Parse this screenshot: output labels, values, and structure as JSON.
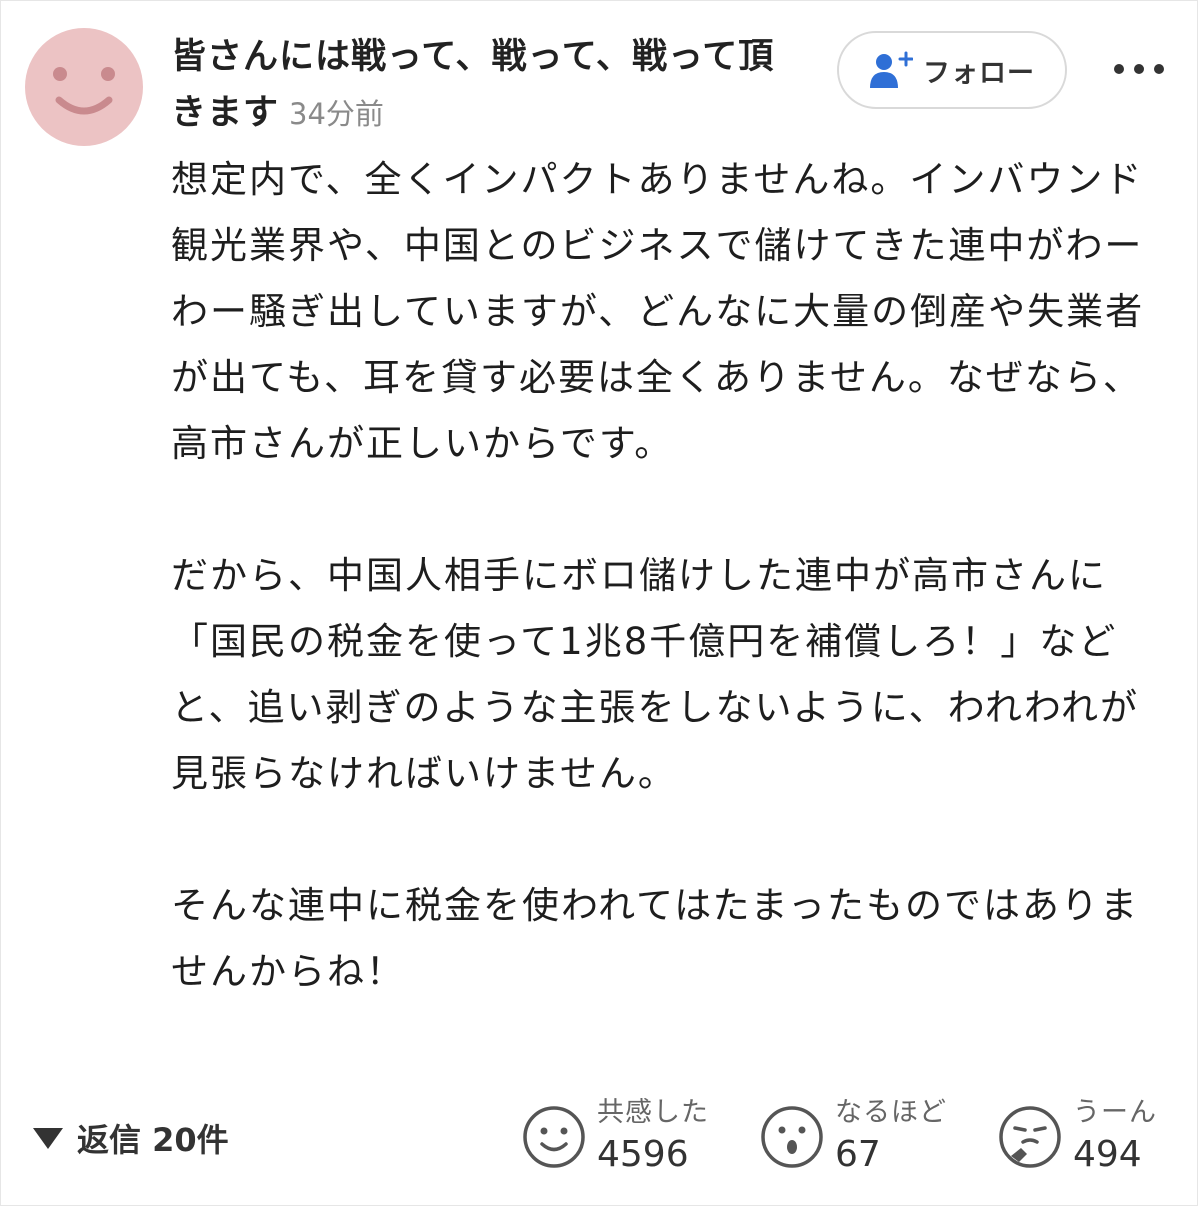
{
  "comment": {
    "username": "皆さんには戦って、戦って、戦って頂きます",
    "timestamp": "34分前",
    "follow_label": "フォロー",
    "more_label": "•••",
    "paragraphs": [
      "想定内で、全くインパクトありませんね。インバウンド観光業界や、中国とのビジネスで儲けてきた連中がわーわー騒ぎ出していますが、どんなに大量の倒産や失業者が出ても、耳を貸す必要は全くありません。なぜなら、高市さんが正しいからです。",
      "だから、中国人相手にボロ儲けした連中が高市さんに「国民の税金を使って1兆8千億円を補償しろ！」などと、追い剥ぎのような主張をしないように、われわれが見張らなければいけません。",
      "そんな連中に税金を使われてはたまったものではありませんからね！"
    ]
  },
  "footer": {
    "replies_label": "返信 20件",
    "reactions": [
      {
        "label": "共感した",
        "count": "4596",
        "icon": "smile-face-icon"
      },
      {
        "label": "なるほど",
        "count": "67",
        "icon": "surprised-face-icon"
      },
      {
        "label": "うーん",
        "count": "494",
        "icon": "thinking-face-icon"
      }
    ]
  },
  "colors": {
    "avatar_bg": "#ecc3c4",
    "avatar_face": "#c98a8e",
    "follow_icon": "#2f6fd6",
    "text_primary": "#1e1e1e",
    "text_muted": "#8a8a8a"
  }
}
